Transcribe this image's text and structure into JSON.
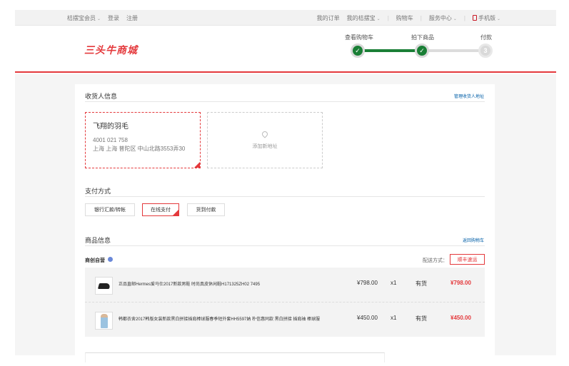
{
  "topbar": {
    "left": [
      "桔摆宝会员",
      "登录",
      "注册"
    ],
    "right": [
      "我的订单",
      "我的桔摆宝",
      "购物车",
      "服务中心",
      "手机版"
    ]
  },
  "header": {
    "logo": "三头牛商城",
    "steps": [
      {
        "label": "查看购物车",
        "state": "done"
      },
      {
        "label": "拍下商品",
        "state": "done"
      },
      {
        "label": "付款",
        "state": "todo",
        "num": "3"
      }
    ]
  },
  "receiver": {
    "title": "收货人信息",
    "manage_link": "管理收货人地址",
    "selected": {
      "name": "飞翔的羽毛",
      "phone": "4001 021 758",
      "address": "上海 上海 普陀区 中山北路3553弄30"
    },
    "add_label": "添加新地址"
  },
  "payment": {
    "title": "支付方式",
    "options": [
      "银行汇款/转帐",
      "在线支付",
      "货到付款"
    ],
    "selected_index": 1
  },
  "goods": {
    "title": "商品信息",
    "back_link": "返回购物车",
    "shop": "商创自营",
    "shipping_label": "配送方式：",
    "shipping_value": "顺丰速运",
    "items": [
      {
        "name": "正品直邮Hermes爱马仕2017新款男鞋 时尚真皮休闲鞋H171325ZH02 7495",
        "price": "¥798.00",
        "qty": "x1",
        "stock": "有货",
        "total": "¥798.00"
      },
      {
        "name": "韩都衣舍2017韩版女装新款黑白拼接插肩棒球服春季短外套HH5597妠 朴信惠同款 黑白拼接 插肩袖 棒球服",
        "price": "¥450.00",
        "qty": "x1",
        "stock": "有货",
        "total": "¥450.00"
      }
    ]
  },
  "colors": {
    "accent": "#e4393c",
    "step_done": "#1a7f36",
    "link": "#005ea7"
  }
}
